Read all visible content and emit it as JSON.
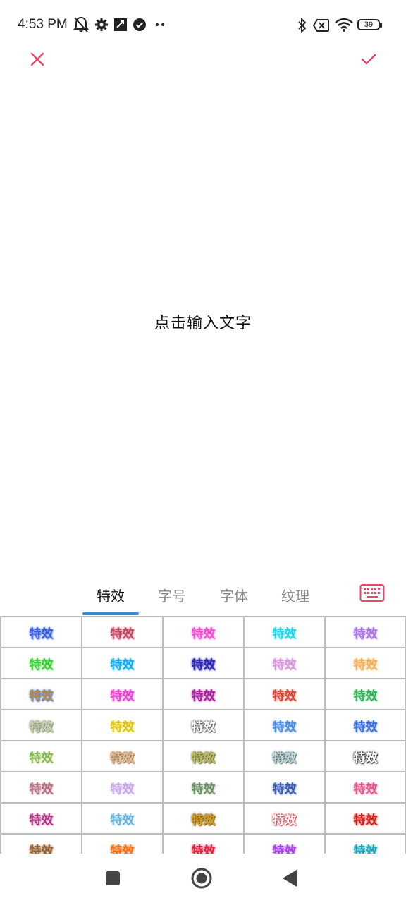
{
  "status_bar": {
    "time": "4:53 PM",
    "battery_level": "39",
    "icons": [
      "mute-notifications-icon",
      "settings-icon",
      "sync-icon",
      "check-circle-icon",
      "more-dots-icon",
      "bluetooth-icon",
      "sim-x-icon",
      "wifi-icon",
      "battery-icon"
    ]
  },
  "toolbar": {
    "close_icon": "close-icon",
    "confirm_icon": "check-icon",
    "accent_color": "#e8476a"
  },
  "canvas": {
    "placeholder": "点击输入文字"
  },
  "tabs": {
    "items": [
      {
        "label": "特效",
        "active": true
      },
      {
        "label": "字号",
        "active": false
      },
      {
        "label": "字体",
        "active": false
      },
      {
        "label": "纹理",
        "active": false
      }
    ],
    "keyboard_icon": "keyboard-icon",
    "underline_color": "#3b8ad8"
  },
  "effects": {
    "label": "特效",
    "rows": [
      [
        {
          "color": "#3b5bd6",
          "glow": "#8aa6ff"
        },
        {
          "color": "#b8485e",
          "glow": "#f29bb0"
        },
        {
          "color": "#f04bd0",
          "glow": "#f9a8ec"
        },
        {
          "color": "#1fd4e8",
          "glow": "#a8f4ff"
        },
        {
          "color": "#a872e0",
          "glow": "#d9c0ff"
        }
      ],
      [
        {
          "color": "#3cc83c",
          "glow": "#a8f0a0"
        },
        {
          "color": "#1aa6e8",
          "glow": "#8fe0ff"
        },
        {
          "color": "#2a2a9a",
          "glow": "#7f6cff"
        },
        {
          "color": "#d49ad8",
          "glow": "#f0d0f2"
        },
        {
          "color": "#f0b060",
          "glow": "#ffd8a8"
        }
      ],
      [
        {
          "color": "#b88a2c",
          "glow": "#6a8cff"
        },
        {
          "color": "#e048c8",
          "glow": "#ff9ef0"
        },
        {
          "color": "#8a2c9a",
          "glow": "#ff7ad0"
        },
        {
          "color": "#d6463a",
          "glow": "#ffb0a0"
        },
        {
          "color": "#3ca85c",
          "glow": "#a8f0c0"
        }
      ],
      [
        {
          "color": "#c8d0b8",
          "glow": "#8a9a70"
        },
        {
          "color": "#d8c020",
          "glow": "#fff080"
        },
        {
          "color": "#ffffff",
          "glow": "#606060"
        },
        {
          "color": "#4a8ae0",
          "glow": "#b0d0ff"
        },
        {
          "color": "#3a6ad8",
          "glow": "#a8c8ff"
        }
      ],
      [
        {
          "color": "#8ab060",
          "glow": "#d8f0b0"
        },
        {
          "color": "#e0c0a0",
          "glow": "#a07840"
        },
        {
          "color": "#c0c060",
          "glow": "#707040"
        },
        {
          "color": "#c8d8d8",
          "glow": "#507070"
        },
        {
          "color": "#ffffff",
          "glow": "#303030"
        }
      ],
      [
        {
          "color": "#b07080",
          "glow": "#e0c0c8"
        },
        {
          "color": "#c8a8e0",
          "glow": "#e8d8ff"
        },
        {
          "color": "#708868",
          "glow": "#c0d8c0"
        },
        {
          "color": "#3a5aa8",
          "glow": "#a8b8e8"
        },
        {
          "color": "#d85a8a",
          "glow": "#ffb0d0"
        }
      ],
      [
        {
          "color": "#9a3a7a",
          "glow": "#f0a8d8"
        },
        {
          "color": "#6ab0d8",
          "glow": "#c8e8f8"
        },
        {
          "color": "#d8a020",
          "glow": "#806020"
        },
        {
          "color": "#ffffff",
          "glow": "#d84050"
        },
        {
          "color": "#c82020",
          "glow": "#ff9080"
        }
      ],
      [
        {
          "color": "#8a6040",
          "glow": "#d0a070"
        },
        {
          "color": "#f07020",
          "glow": "#ffb070"
        },
        {
          "color": "#e02040",
          "glow": "#ff90a0"
        },
        {
          "color": "#a040e0",
          "glow": "#e0a0ff"
        },
        {
          "color": "#20a0b0",
          "glow": "#90e0e8"
        }
      ]
    ]
  },
  "nav_bar": {
    "icons": [
      "recents-square-icon",
      "home-circle-icon",
      "back-triangle-icon"
    ]
  }
}
